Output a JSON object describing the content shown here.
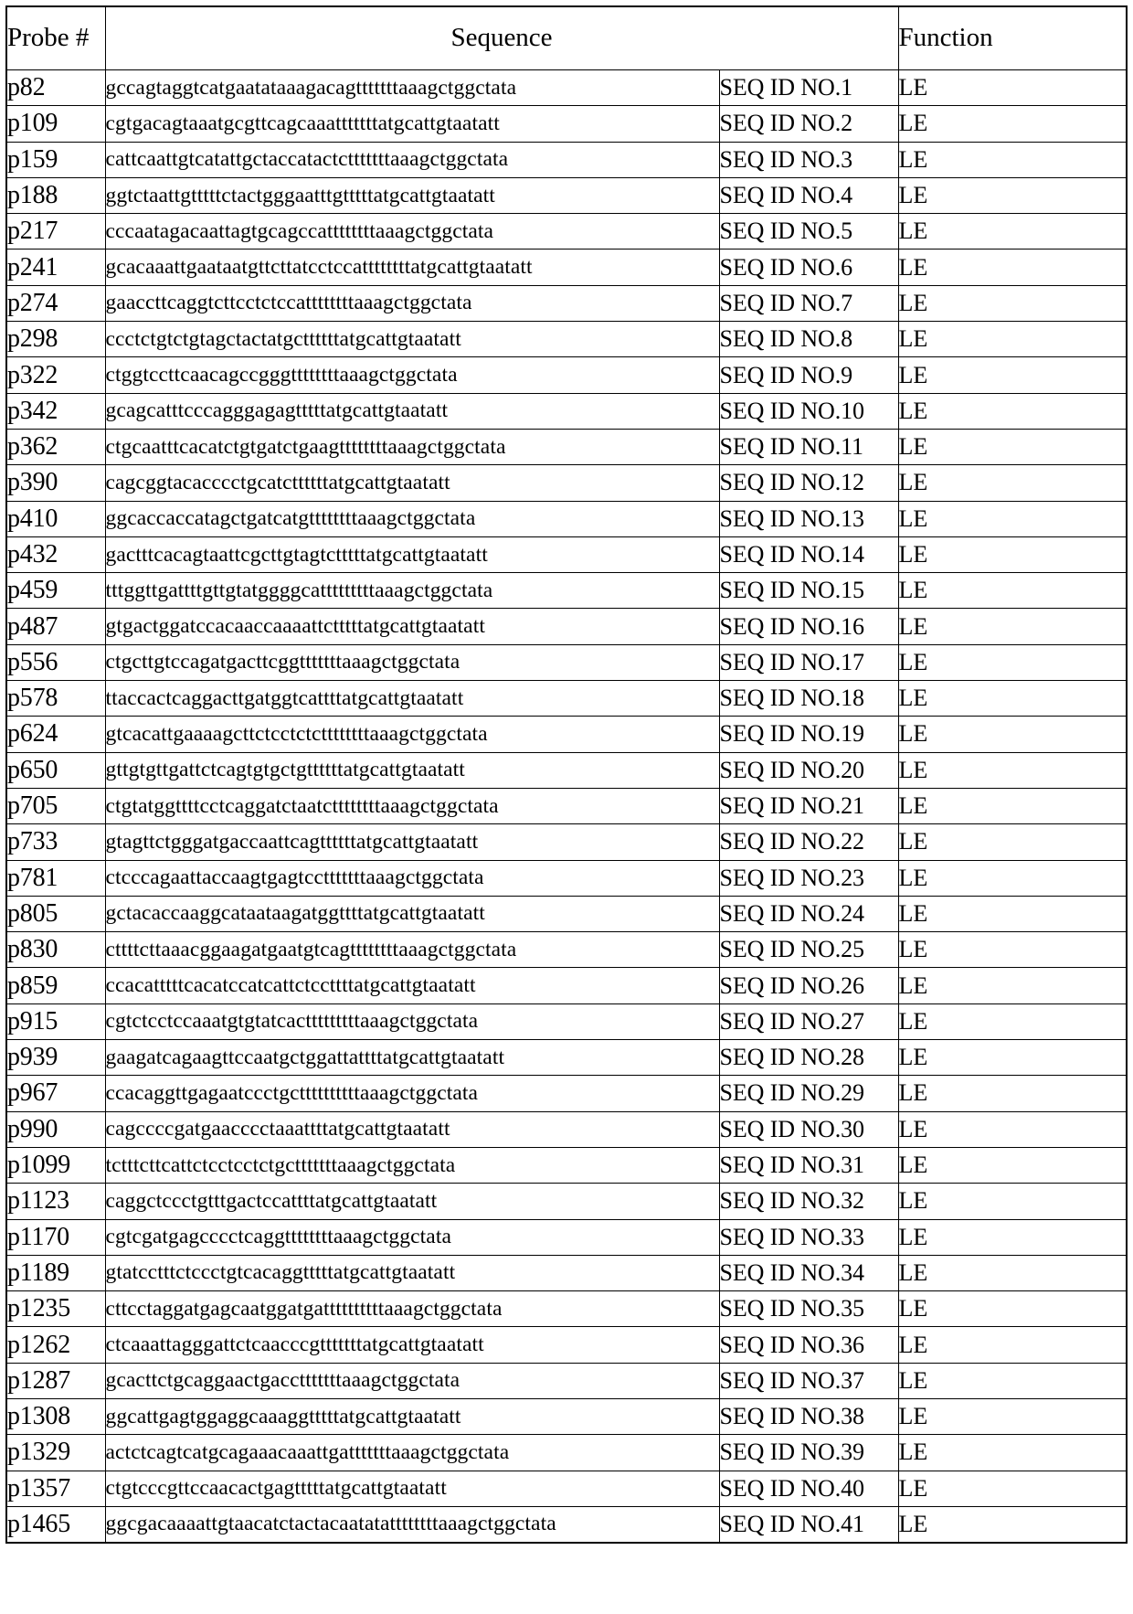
{
  "table": {
    "headers": {
      "probe": "Probe #",
      "sequence": "Sequence",
      "function": "Function"
    },
    "rows": [
      {
        "probe": "p82",
        "sequence": "gccagtaggtcatgaatataaagacagtttttttaaagctggctata",
        "seqid": "SEQ ID NO.1",
        "function": "LE"
      },
      {
        "probe": "p109",
        "sequence": "cgtgacagtaaatgcgttcagcaaatttttttatgcattgtaatatt",
        "seqid": "SEQ ID NO.2",
        "function": "LE"
      },
      {
        "probe": "p159",
        "sequence": "cattcaattgtcatattgctaccatactctttttttaaagctggctata",
        "seqid": "SEQ ID NO.3",
        "function": "LE"
      },
      {
        "probe": "p188",
        "sequence": "ggtctaattgtttttctactgggaatttgtttttatgcattgtaatatt",
        "seqid": "SEQ ID NO.4",
        "function": "LE"
      },
      {
        "probe": "p217",
        "sequence": "cccaatagacaattagtgcagccattttttttaaagctggctata",
        "seqid": "SEQ ID NO.5",
        "function": "LE"
      },
      {
        "probe": "p241",
        "sequence": "gcacaaattgaataatgttcttatcctccattttttttatgcattgtaatatt",
        "seqid": "SEQ ID NO.6",
        "function": "LE"
      },
      {
        "probe": "p274",
        "sequence": "gaaccttcaggtcttcctctccattttttttaaagctggctata",
        "seqid": "SEQ ID NO.7",
        "function": "LE"
      },
      {
        "probe": "p298",
        "sequence": "ccctctgtctgtagctactatgcttttttatgcattgtaatatt",
        "seqid": "SEQ ID NO.8",
        "function": "LE"
      },
      {
        "probe": "p322",
        "sequence": "ctggtccttcaacagccgggttttttttaaagctggctata",
        "seqid": "SEQ ID NO.9",
        "function": "LE"
      },
      {
        "probe": "p342",
        "sequence": "gcagcatttcccagggagagtttttatgcattgtaatatt",
        "seqid": "SEQ ID NO.10",
        "function": "LE"
      },
      {
        "probe": "p362",
        "sequence": "ctgcaatttcacatctgtgatctgaagttttttttaaagctggctata",
        "seqid": "SEQ ID NO.11",
        "function": "LE"
      },
      {
        "probe": "p390",
        "sequence": "cagcggtacacccctgcatcttttttatgcattgtaatatt",
        "seqid": "SEQ ID NO.12",
        "function": "LE"
      },
      {
        "probe": "p410",
        "sequence": "ggcaccaccatagctgatcatgttttttttaaagctggctata",
        "seqid": "SEQ ID NO.13",
        "function": "LE"
      },
      {
        "probe": "p432",
        "sequence": "gactttcacagtaattcgcttgtagtctttttatgcattgtaatatt",
        "seqid": "SEQ ID NO.14",
        "function": "LE"
      },
      {
        "probe": "p459",
        "sequence": "tttggttgattttgttgtatggggcatttttttttaaagctggctata",
        "seqid": "SEQ ID NO.15",
        "function": "LE"
      },
      {
        "probe": "p487",
        "sequence": "gtgactggatccacaaccaaaattctttttatgcattgtaatatt",
        "seqid": "SEQ ID NO.16",
        "function": "LE"
      },
      {
        "probe": "p556",
        "sequence": "ctgcttgtccagatgacttcggtttttttaaagctggctata",
        "seqid": "SEQ ID NO.17",
        "function": "LE"
      },
      {
        "probe": "p578",
        "sequence": "ttaccactcaggacttgatggtcattttatgcattgtaatatt",
        "seqid": "SEQ ID NO.18",
        "function": "LE"
      },
      {
        "probe": "p624",
        "sequence": "gtcacattgaaaagcttctcctctcttttttttaaagctggctata",
        "seqid": "SEQ ID NO.19",
        "function": "LE"
      },
      {
        "probe": "p650",
        "sequence": "gttgtgttgattctcagtgtgctgttttttatgcattgtaatatt",
        "seqid": "SEQ ID NO.20",
        "function": "LE"
      },
      {
        "probe": "p705",
        "sequence": "ctgtatggttttcctcaggatctaatcttttttttaaagctggctata",
        "seqid": "SEQ ID NO.21",
        "function": "LE"
      },
      {
        "probe": "p733",
        "sequence": "gtagttctgggatgaccaattcagttttttatgcattgtaatatt",
        "seqid": "SEQ ID NO.22",
        "function": "LE"
      },
      {
        "probe": "p781",
        "sequence": "ctcccagaattaccaagtgagtcctttttttaaagctggctata",
        "seqid": "SEQ ID NO.23",
        "function": "LE"
      },
      {
        "probe": "p805",
        "sequence": "gctacaccaaggcataataagatggttttatgcattgtaatatt",
        "seqid": "SEQ ID NO.24",
        "function": "LE"
      },
      {
        "probe": "p830",
        "sequence": "cttttcttaaacggaagatgaatgtcagttttttttaaagctggctata",
        "seqid": "SEQ ID NO.25",
        "function": "LE"
      },
      {
        "probe": "p859",
        "sequence": "ccacatttttcacatccatcattctccttttatgcattgtaatatt",
        "seqid": "SEQ ID NO.26",
        "function": "LE"
      },
      {
        "probe": "p915",
        "sequence": "cgtctcctccaaatgtgtatcactttttttttaaagctggctata",
        "seqid": "SEQ ID NO.27",
        "function": "LE"
      },
      {
        "probe": "p939",
        "sequence": "gaagatcagaagttccaatgctggattattttatgcattgtaatatt",
        "seqid": "SEQ ID NO.28",
        "function": "LE"
      },
      {
        "probe": "p967",
        "sequence": "ccacaggttgagaatccctgcttttttttttaaagctggctata",
        "seqid": "SEQ ID NO.29",
        "function": "LE"
      },
      {
        "probe": "p990",
        "sequence": "cagccccgatgaacccctaaattttatgcattgtaatatt",
        "seqid": "SEQ ID NO.30",
        "function": "LE"
      },
      {
        "probe": "p1099",
        "sequence": "tctttcttcattctcctcctctgctttttttaaagctggctata",
        "seqid": "SEQ ID NO.31",
        "function": "LE"
      },
      {
        "probe": "p1123",
        "sequence": "caggctccctgtttgactccattttatgcattgtaatatt",
        "seqid": "SEQ ID NO.32",
        "function": "LE"
      },
      {
        "probe": "p1170",
        "sequence": "cgtcgatgagcccctcaggttttttttaaagctggctata",
        "seqid": "SEQ ID NO.33",
        "function": "LE"
      },
      {
        "probe": "p1189",
        "sequence": "gtatcctttctccctgtcacaggtttttatgcattgtaatatt",
        "seqid": "SEQ ID NO.34",
        "function": "LE"
      },
      {
        "probe": "p1235",
        "sequence": "cttcctaggatgagcaatggatgattttttttttaaagctggctata",
        "seqid": "SEQ ID NO.35",
        "function": "LE"
      },
      {
        "probe": "p1262",
        "sequence": "ctcaaattagggattctcaacccgtttttttatgcattgtaatatt",
        "seqid": "SEQ ID NO.36",
        "function": "LE"
      },
      {
        "probe": "p1287",
        "sequence": "gcacttctgcaggaactgacctttttttaaagctggctata",
        "seqid": "SEQ ID NO.37",
        "function": "LE"
      },
      {
        "probe": "p1308",
        "sequence": "ggcattgagtggaggcaaaggtttttatgcattgtaatatt",
        "seqid": "SEQ ID NO.38",
        "function": "LE"
      },
      {
        "probe": "p1329",
        "sequence": "actctcagtcatgcagaaacaaattgatttttttaaagctggctata",
        "seqid": "SEQ ID NO.39",
        "function": "LE"
      },
      {
        "probe": "p1357",
        "sequence": "ctgtcccgttccaacactgagtttttatgcattgtaatatt",
        "seqid": "SEQ ID NO.40",
        "function": "LE"
      },
      {
        "probe": "p1465",
        "sequence": "ggcgacaaaattgtaacatctactacaatatattttttttaaagctggctata",
        "seqid": "SEQ ID NO.41",
        "function": "LE"
      }
    ]
  }
}
